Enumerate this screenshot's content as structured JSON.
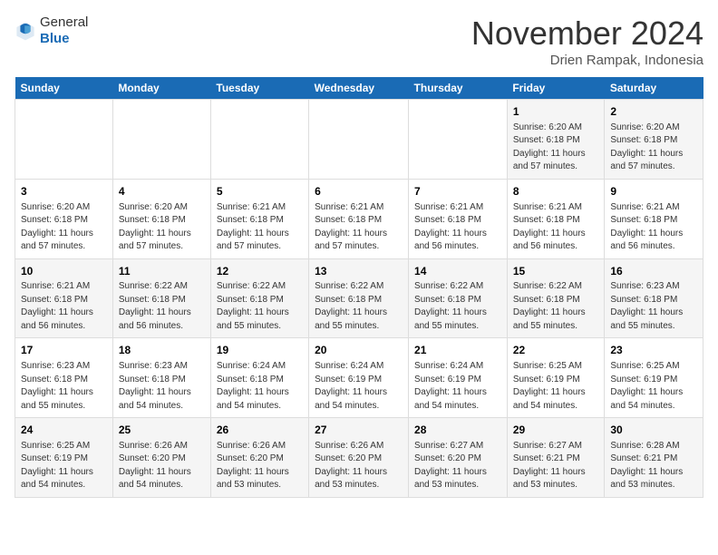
{
  "logo": {
    "text_general": "General",
    "text_blue": "Blue"
  },
  "header": {
    "month_year": "November 2024",
    "location": "Drien Rampak, Indonesia"
  },
  "days_of_week": [
    "Sunday",
    "Monday",
    "Tuesday",
    "Wednesday",
    "Thursday",
    "Friday",
    "Saturday"
  ],
  "weeks": [
    [
      {
        "day": "",
        "info": ""
      },
      {
        "day": "",
        "info": ""
      },
      {
        "day": "",
        "info": ""
      },
      {
        "day": "",
        "info": ""
      },
      {
        "day": "",
        "info": ""
      },
      {
        "day": "1",
        "info": "Sunrise: 6:20 AM\nSunset: 6:18 PM\nDaylight: 11 hours\nand 57 minutes."
      },
      {
        "day": "2",
        "info": "Sunrise: 6:20 AM\nSunset: 6:18 PM\nDaylight: 11 hours\nand 57 minutes."
      }
    ],
    [
      {
        "day": "3",
        "info": "Sunrise: 6:20 AM\nSunset: 6:18 PM\nDaylight: 11 hours\nand 57 minutes."
      },
      {
        "day": "4",
        "info": "Sunrise: 6:20 AM\nSunset: 6:18 PM\nDaylight: 11 hours\nand 57 minutes."
      },
      {
        "day": "5",
        "info": "Sunrise: 6:21 AM\nSunset: 6:18 PM\nDaylight: 11 hours\nand 57 minutes."
      },
      {
        "day": "6",
        "info": "Sunrise: 6:21 AM\nSunset: 6:18 PM\nDaylight: 11 hours\nand 57 minutes."
      },
      {
        "day": "7",
        "info": "Sunrise: 6:21 AM\nSunset: 6:18 PM\nDaylight: 11 hours\nand 56 minutes."
      },
      {
        "day": "8",
        "info": "Sunrise: 6:21 AM\nSunset: 6:18 PM\nDaylight: 11 hours\nand 56 minutes."
      },
      {
        "day": "9",
        "info": "Sunrise: 6:21 AM\nSunset: 6:18 PM\nDaylight: 11 hours\nand 56 minutes."
      }
    ],
    [
      {
        "day": "10",
        "info": "Sunrise: 6:21 AM\nSunset: 6:18 PM\nDaylight: 11 hours\nand 56 minutes."
      },
      {
        "day": "11",
        "info": "Sunrise: 6:22 AM\nSunset: 6:18 PM\nDaylight: 11 hours\nand 56 minutes."
      },
      {
        "day": "12",
        "info": "Sunrise: 6:22 AM\nSunset: 6:18 PM\nDaylight: 11 hours\nand 55 minutes."
      },
      {
        "day": "13",
        "info": "Sunrise: 6:22 AM\nSunset: 6:18 PM\nDaylight: 11 hours\nand 55 minutes."
      },
      {
        "day": "14",
        "info": "Sunrise: 6:22 AM\nSunset: 6:18 PM\nDaylight: 11 hours\nand 55 minutes."
      },
      {
        "day": "15",
        "info": "Sunrise: 6:22 AM\nSunset: 6:18 PM\nDaylight: 11 hours\nand 55 minutes."
      },
      {
        "day": "16",
        "info": "Sunrise: 6:23 AM\nSunset: 6:18 PM\nDaylight: 11 hours\nand 55 minutes."
      }
    ],
    [
      {
        "day": "17",
        "info": "Sunrise: 6:23 AM\nSunset: 6:18 PM\nDaylight: 11 hours\nand 55 minutes."
      },
      {
        "day": "18",
        "info": "Sunrise: 6:23 AM\nSunset: 6:18 PM\nDaylight: 11 hours\nand 54 minutes."
      },
      {
        "day": "19",
        "info": "Sunrise: 6:24 AM\nSunset: 6:18 PM\nDaylight: 11 hours\nand 54 minutes."
      },
      {
        "day": "20",
        "info": "Sunrise: 6:24 AM\nSunset: 6:19 PM\nDaylight: 11 hours\nand 54 minutes."
      },
      {
        "day": "21",
        "info": "Sunrise: 6:24 AM\nSunset: 6:19 PM\nDaylight: 11 hours\nand 54 minutes."
      },
      {
        "day": "22",
        "info": "Sunrise: 6:25 AM\nSunset: 6:19 PM\nDaylight: 11 hours\nand 54 minutes."
      },
      {
        "day": "23",
        "info": "Sunrise: 6:25 AM\nSunset: 6:19 PM\nDaylight: 11 hours\nand 54 minutes."
      }
    ],
    [
      {
        "day": "24",
        "info": "Sunrise: 6:25 AM\nSunset: 6:19 PM\nDaylight: 11 hours\nand 54 minutes."
      },
      {
        "day": "25",
        "info": "Sunrise: 6:26 AM\nSunset: 6:20 PM\nDaylight: 11 hours\nand 54 minutes."
      },
      {
        "day": "26",
        "info": "Sunrise: 6:26 AM\nSunset: 6:20 PM\nDaylight: 11 hours\nand 53 minutes."
      },
      {
        "day": "27",
        "info": "Sunrise: 6:26 AM\nSunset: 6:20 PM\nDaylight: 11 hours\nand 53 minutes."
      },
      {
        "day": "28",
        "info": "Sunrise: 6:27 AM\nSunset: 6:20 PM\nDaylight: 11 hours\nand 53 minutes."
      },
      {
        "day": "29",
        "info": "Sunrise: 6:27 AM\nSunset: 6:21 PM\nDaylight: 11 hours\nand 53 minutes."
      },
      {
        "day": "30",
        "info": "Sunrise: 6:28 AM\nSunset: 6:21 PM\nDaylight: 11 hours\nand 53 minutes."
      }
    ]
  ]
}
